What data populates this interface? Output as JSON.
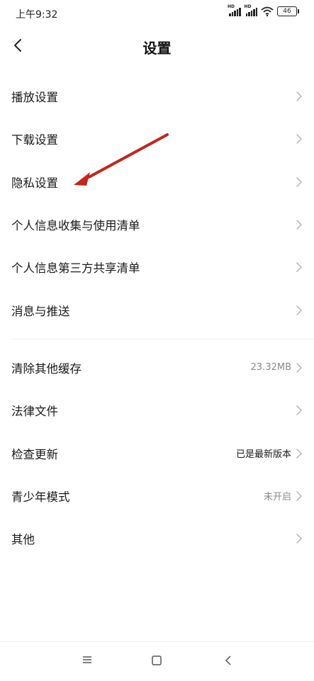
{
  "status_bar": {
    "time": "上午9:32",
    "signal_label": "HD",
    "battery": "46"
  },
  "header": {
    "title": "设置"
  },
  "groups": [
    {
      "items": [
        {
          "label": "播放设置",
          "value": ""
        },
        {
          "label": "下载设置",
          "value": ""
        },
        {
          "label": "隐私设置",
          "value": ""
        },
        {
          "label": "个人信息收集与使用清单",
          "value": ""
        },
        {
          "label": "个人信息第三方共享清单",
          "value": ""
        },
        {
          "label": "消息与推送",
          "value": ""
        }
      ]
    },
    {
      "items": [
        {
          "label": "清除其他缓存",
          "value": "23.32MB"
        },
        {
          "label": "法律文件",
          "value": ""
        },
        {
          "label": "检查更新",
          "value": "已是最新版本"
        },
        {
          "label": "青少年模式",
          "value": "未开启"
        },
        {
          "label": "其他",
          "value": ""
        }
      ]
    }
  ],
  "colors": {
    "arrow": "#c0271f",
    "chevron": "#b5b5b5"
  }
}
